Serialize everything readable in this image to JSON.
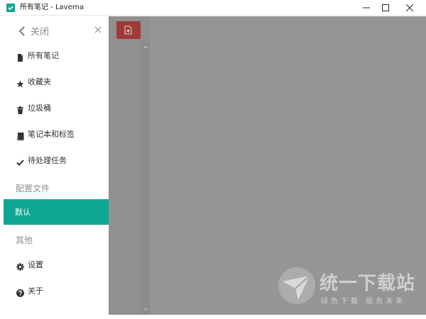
{
  "window": {
    "title": "所有笔记 - Laverna",
    "minimize_icon": "minimize-icon",
    "maximize_icon": "maximize-icon",
    "close_icon": "close-icon",
    "app_color": "#11a68f"
  },
  "sidebar": {
    "header": {
      "back_icon": "chevron-left-icon",
      "label": "关闭",
      "close_icon": "close-x-icon"
    },
    "items": [
      {
        "label": "所有笔记",
        "icon": "file-icon"
      },
      {
        "label": "收藏夹",
        "icon": "star-icon"
      },
      {
        "label": "垃圾桶",
        "icon": "trash-icon"
      },
      {
        "label": "笔记本和标签",
        "icon": "book-icon"
      },
      {
        "label": "待处理任务",
        "icon": "check-icon"
      }
    ],
    "sections": {
      "profiles_title": "配置文件",
      "profiles": [
        {
          "label": "默认",
          "active": true
        }
      ],
      "other_title": "其他",
      "other_items": [
        {
          "label": "设置",
          "icon": "gear-icon"
        },
        {
          "label": "关于",
          "icon": "question-circle-icon"
        }
      ]
    },
    "active_color": "#10a792"
  },
  "content": {
    "new_note_icon": "new-note-icon",
    "new_note_color": "#9e3b37",
    "background": "#959595"
  },
  "watermark": {
    "title": "统一下载站",
    "subtitle": "绿色下载 服务未来"
  }
}
